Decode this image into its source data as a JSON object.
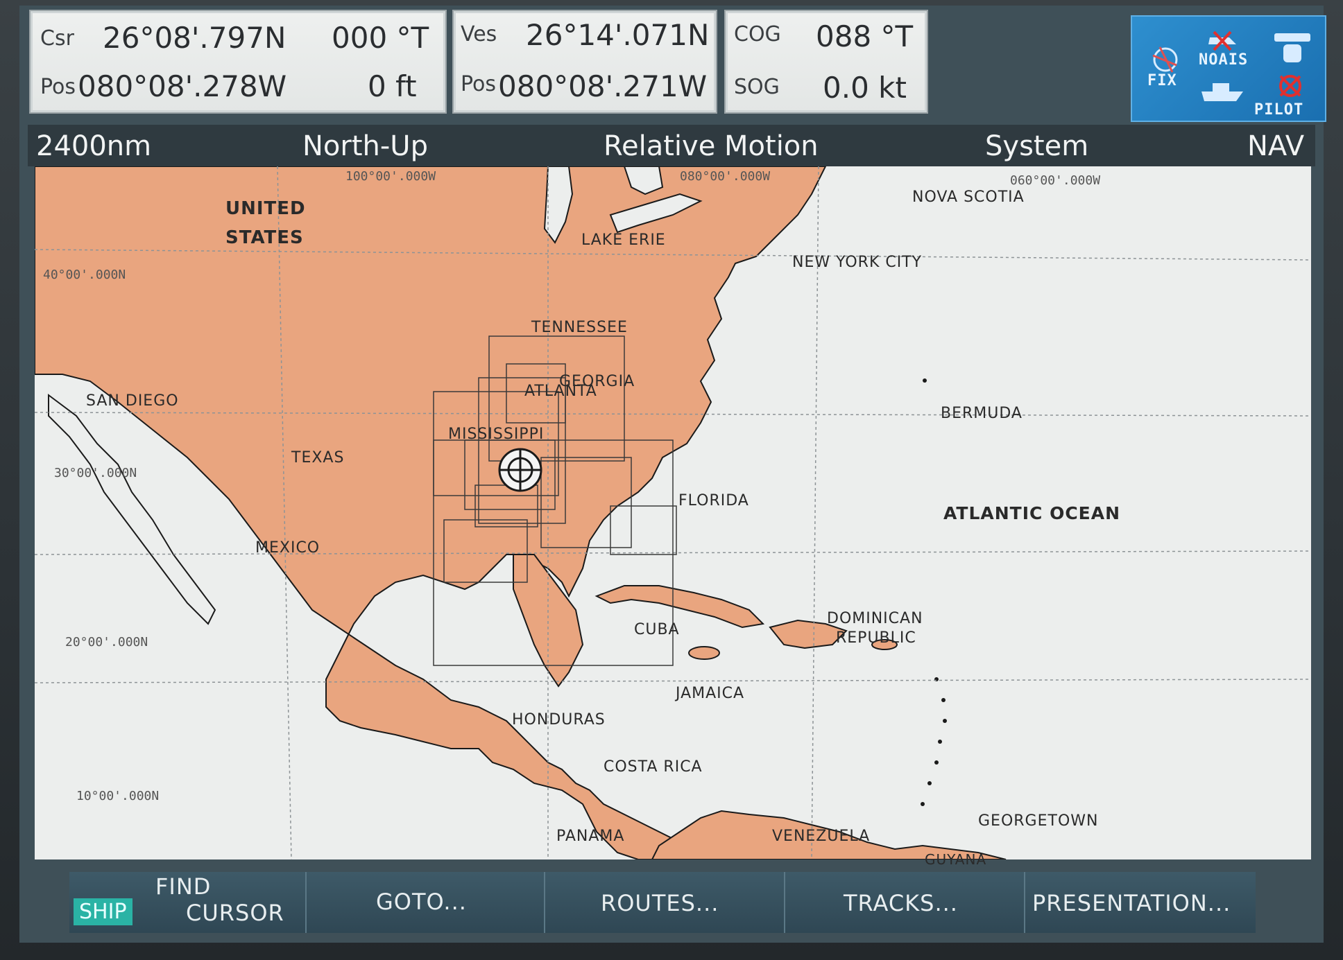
{
  "cursor_box": {
    "csr_label": "Csr",
    "lat": "26°08'.797N",
    "bearing": "000 °T",
    "pos_label": "Pos",
    "lon": "080°08'.278W",
    "range": "0 ft"
  },
  "vessel_box": {
    "ves_label": "Ves",
    "lat": "26°14'.071N",
    "pos_label": "Pos",
    "lon": "080°08'.271W"
  },
  "course_box": {
    "cog_label": "COG",
    "cog_value": "088 °T",
    "sog_label": "SOG",
    "sog_value": "0.0 kt"
  },
  "fix_panel": {
    "fix": "FIX",
    "noais": "NOAIS",
    "pilot": "PILOT"
  },
  "status": {
    "range": "2400nm",
    "orientation": "North-Up",
    "motion": "Relative Motion",
    "mode": "System",
    "nav": "NAV"
  },
  "grid_labels": {
    "lon_100": "100°00'.000W",
    "lon_080": "080°00'.000W",
    "lon_060": "060°00'.000W",
    "lat_40": "40°00'.000N",
    "lat_30": "30°00'.000N",
    "lat_20": "20°00'.000N",
    "lat_10": "10°00'.000N"
  },
  "places": {
    "united": "UNITED",
    "states": "STATES",
    "lake_erie": "LAKE ERIE",
    "nova_scotia": "NOVA SCOTIA",
    "new_york_city": "NEW YORK CITY",
    "tennessee": "TENNESSEE",
    "georgia": "GEORGIA",
    "atlanta": "ATLANTA",
    "san_diego": "SAN DIEGO",
    "bermuda": "BERMUDA",
    "mississippi": "MISSISSIPPI",
    "texas": "TEXAS",
    "florida": "FLORIDA",
    "atlantic_ocean": "ATLANTIC OCEAN",
    "mexico": "MEXICO",
    "dominican": "DOMINICAN",
    "republic": "REPUBLIC",
    "cuba": "CUBA",
    "jamaica": "JAMAICA",
    "honduras": "HONDURAS",
    "costa_rica": "COSTA RICA",
    "georgetown": "GEORGETOWN",
    "panama": "PANAMA",
    "venezuela": "VENEZUELA",
    "guyana": "GUYANA"
  },
  "softkeys": {
    "find": "FIND",
    "ship": "SHIP",
    "cursor": "CURSOR",
    "goto": "GOTO...",
    "routes": "ROUTES...",
    "tracks": "TRACKS...",
    "presentation": "PRESENTATION..."
  },
  "colors": {
    "land": "#e9a57f",
    "water": "#eceeed",
    "grid": "#8d9396",
    "accent": "#2ab3a5"
  }
}
